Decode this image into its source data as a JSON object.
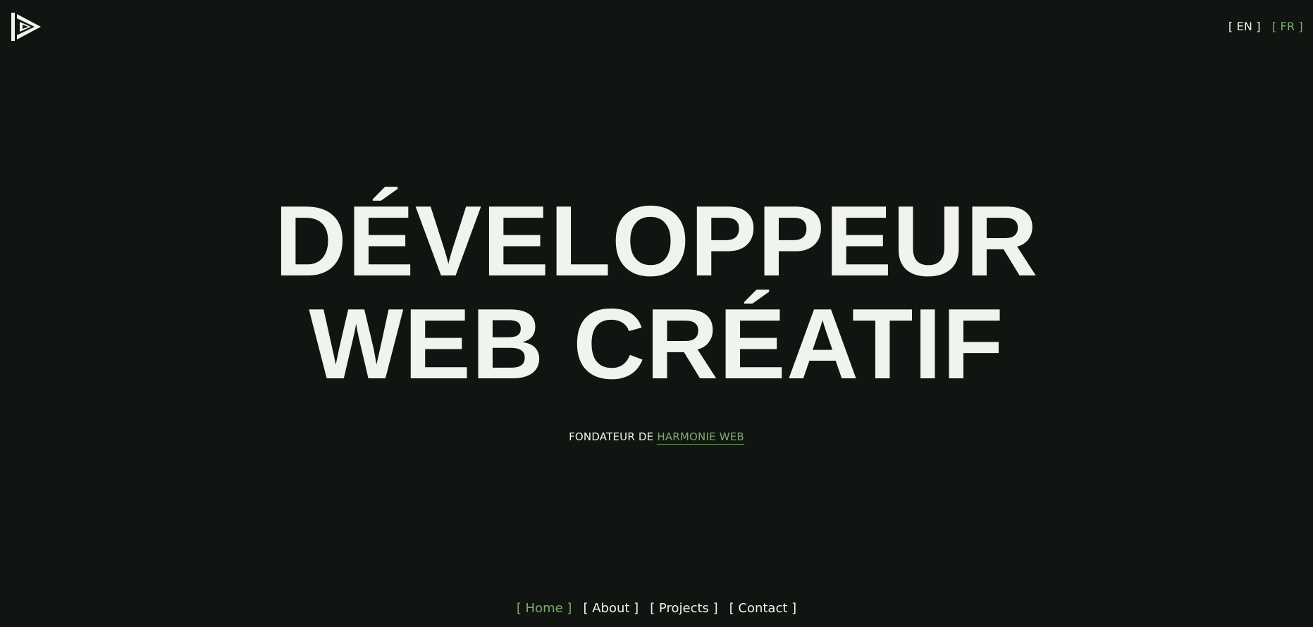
{
  "logo": {
    "icon": "play-triangle-logo-icon"
  },
  "language": {
    "items": [
      {
        "label": "[ EN ]",
        "active": false
      },
      {
        "label": "[ FR ]",
        "active": true
      }
    ]
  },
  "hero": {
    "title_line_1": "DÉVELOPPEUR",
    "title_line_2": "WEB CRÉATIF"
  },
  "subtitle": {
    "prefix": "FONDATEUR DE",
    "link_text": "HARMONIE WEB"
  },
  "nav": {
    "items": [
      {
        "label": "[ Home ]",
        "active": true
      },
      {
        "label": "[ About ]",
        "active": false
      },
      {
        "label": "[ Projects ]",
        "active": false
      },
      {
        "label": "[ Contact ]",
        "active": false
      }
    ]
  },
  "colors": {
    "background": "#101511",
    "text": "#f1f3ee",
    "accent": "#7cab6f"
  }
}
